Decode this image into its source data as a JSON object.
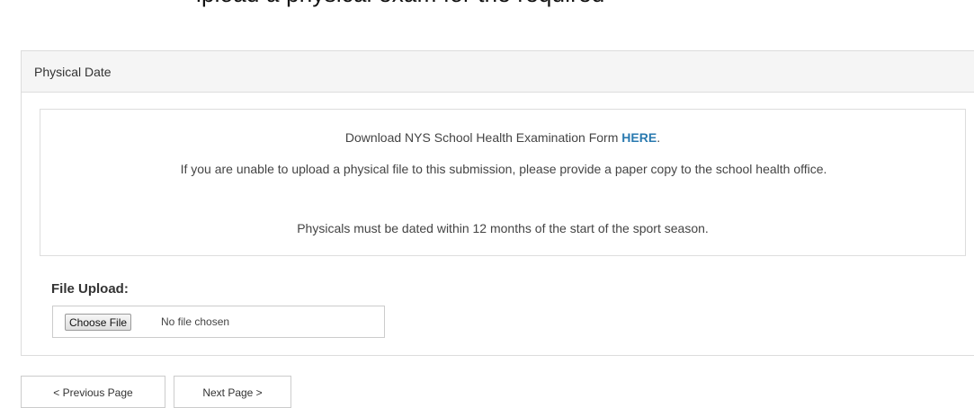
{
  "header_fragment": "ipload a physical exam for the required",
  "panel": {
    "title": "Physical Date",
    "download_prefix": "Download NYS School Health Examination Form ",
    "download_link": "HERE",
    "download_suffix": ".",
    "upload_note": "If you are unable to upload a physical file to this submission, please provide a paper copy to the school health office.",
    "date_note": "Physicals must be dated within 12 months of the start of the sport season."
  },
  "file_upload": {
    "label": "File Upload:",
    "button_label": "Choose File",
    "status_text": "No file chosen"
  },
  "navigation": {
    "previous_label": "< Previous Page",
    "next_label": "Next Page >"
  },
  "colors": {
    "link": "#2a7ab0",
    "panel_heading_bg": "#f5f5f5",
    "border": "#dddddd"
  }
}
